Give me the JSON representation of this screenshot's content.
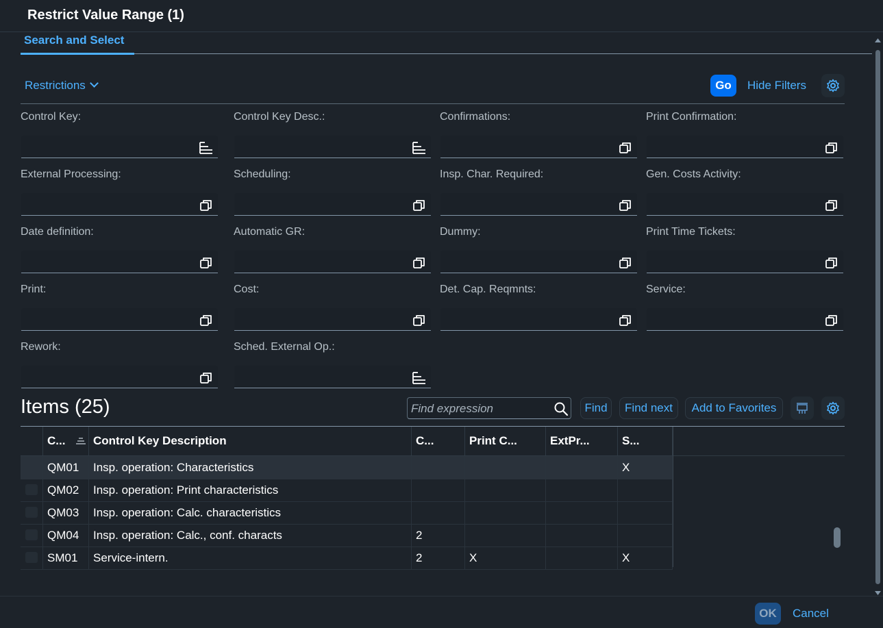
{
  "dialog": {
    "title": "Restrict Value Range (1)",
    "tab": "Search and Select"
  },
  "filterbar": {
    "restrictions_label": "Restrictions",
    "go_label": "Go",
    "hide_filters_label": "Hide Filters"
  },
  "filters": [
    {
      "label": "Control Key:",
      "icon": "list-icon"
    },
    {
      "label": "Control Key Desc.:",
      "icon": "list-icon"
    },
    {
      "label": "Confirmations:",
      "icon": "value-help-icon"
    },
    {
      "label": "Print Confirmation:",
      "icon": "value-help-icon"
    },
    {
      "label": "External Processing:",
      "icon": "value-help-icon"
    },
    {
      "label": "Scheduling:",
      "icon": "value-help-icon"
    },
    {
      "label": "Insp. Char. Required:",
      "icon": "value-help-icon"
    },
    {
      "label": "Gen. Costs Activity:",
      "icon": "value-help-icon"
    },
    {
      "label": "Date definition:",
      "icon": "value-help-icon"
    },
    {
      "label": "Automatic GR:",
      "icon": "value-help-icon"
    },
    {
      "label": "Dummy:",
      "icon": "value-help-icon"
    },
    {
      "label": "Print Time Tickets:",
      "icon": "value-help-icon"
    },
    {
      "label": "Print:",
      "icon": "value-help-icon"
    },
    {
      "label": "Cost:",
      "icon": "value-help-icon"
    },
    {
      "label": "Det. Cap. Reqmnts:",
      "icon": "value-help-icon"
    },
    {
      "label": "Service:",
      "icon": "value-help-icon"
    },
    {
      "label": "Rework:",
      "icon": "value-help-icon"
    },
    {
      "label": "Sched. External Op.:",
      "icon": "list-icon"
    }
  ],
  "items": {
    "title": "Items (25)",
    "find_placeholder": "Find expression",
    "find_label": "Find",
    "find_next_label": "Find next",
    "add_favorites_label": "Add to Favorites"
  },
  "table": {
    "columns": [
      "C...",
      "Control Key Description",
      "C...",
      "Print C...",
      "ExtPr...",
      "S..."
    ],
    "rows": [
      {
        "key": "QM01",
        "desc": "Insp. operation: Characteristics",
        "c": "",
        "print": "",
        "ext": "",
        "s": "X"
      },
      {
        "key": "QM02",
        "desc": "Insp. operation: Print characteristics",
        "c": "",
        "print": "",
        "ext": "",
        "s": ""
      },
      {
        "key": "QM03",
        "desc": "Insp. operation: Calc. characteristics",
        "c": "",
        "print": "",
        "ext": "",
        "s": ""
      },
      {
        "key": "QM04",
        "desc": "Insp. operation: Calc., conf. characts",
        "c": "2",
        "print": "",
        "ext": "",
        "s": ""
      },
      {
        "key": "SM01",
        "desc": "Service-intern.",
        "c": "2",
        "print": "X",
        "ext": "",
        "s": "X"
      }
    ]
  },
  "footer": {
    "ok_label": "OK",
    "cancel_label": "Cancel"
  },
  "colors": {
    "background": "#1d232a",
    "accent": "#4db1ff",
    "emphasized_button": "#0070f2"
  }
}
